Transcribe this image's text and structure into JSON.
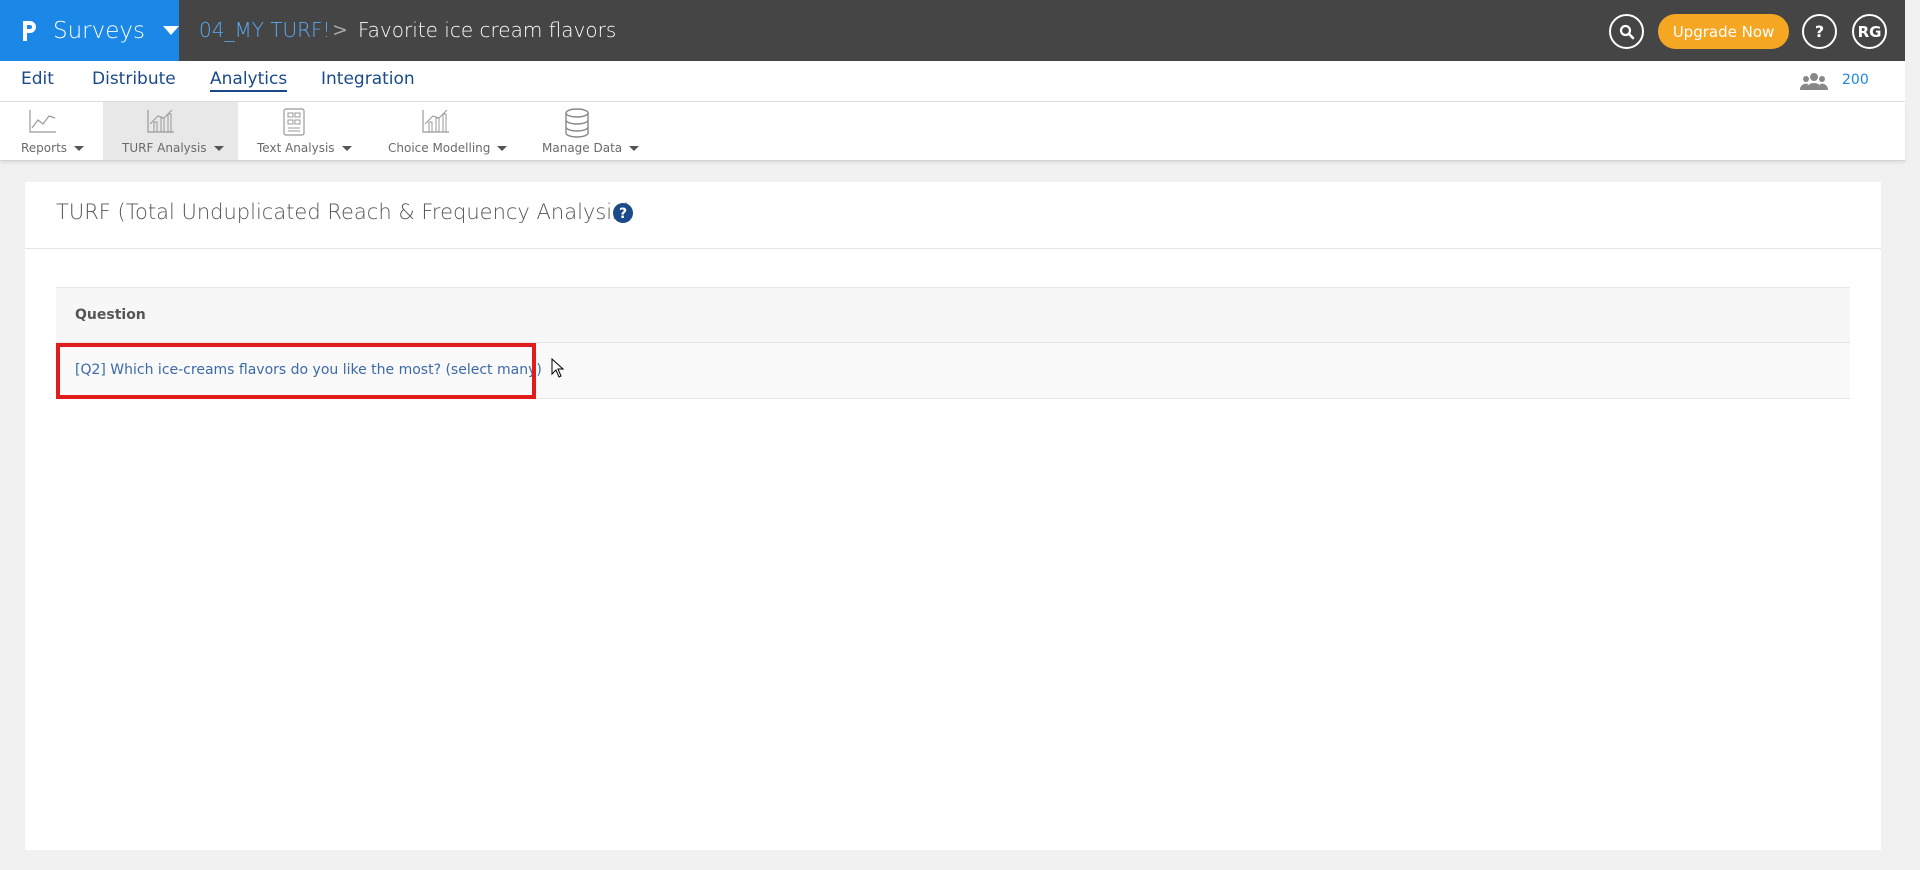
{
  "topbar": {
    "brand": "Surveys",
    "breadcrumb_project": "04_MY TURF!",
    "breadcrumb_sep": ">",
    "page_name": "Favorite ice cream flavors",
    "upgrade_label": "Upgrade Now",
    "help_label": "?",
    "user_initials": "RG",
    "icons": [
      "search-icon",
      "help-icon",
      "avatar"
    ],
    "colors": {
      "brand": "#1b87e6",
      "upgrade": "#f5a623",
      "bar": "#454545"
    }
  },
  "nav": {
    "items": [
      {
        "label": "Edit"
      },
      {
        "label": "Distribute"
      },
      {
        "label": "Analytics",
        "active": true
      },
      {
        "label": "Integration"
      }
    ],
    "responses_count": "200"
  },
  "toolbar": {
    "tools": [
      {
        "label": "Reports",
        "icon": "line-chart-icon"
      },
      {
        "label": "TURF Analysis",
        "icon": "bar-chart-icon",
        "active": true
      },
      {
        "label": "Text Analysis",
        "icon": "text-analysis-icon"
      },
      {
        "label": "Choice Modelling",
        "icon": "choice-chart-icon"
      },
      {
        "label": "Manage Data",
        "icon": "database-icon"
      }
    ]
  },
  "panel": {
    "title": "TURF (Total Unduplicated Reach & Frequency Analysis)",
    "table": {
      "header": "Question",
      "rows": [
        {
          "question": "[Q2] Which ice-creams flavors do you like the most? (select many)",
          "highlighted": true
        }
      ]
    }
  }
}
